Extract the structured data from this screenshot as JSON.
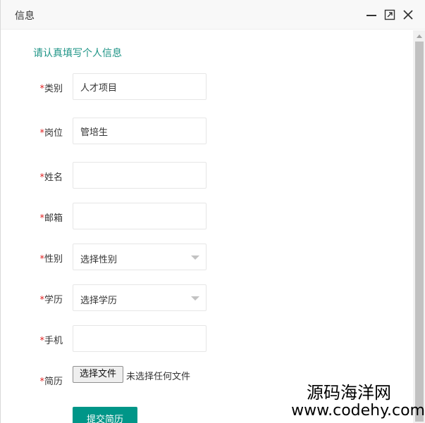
{
  "window": {
    "title": "信息",
    "minimize_icon": "minimize-icon",
    "maximize_icon": "maximize-icon",
    "close_icon": "close-icon"
  },
  "form": {
    "heading": "请认真填写个人信息",
    "required_mark": "*",
    "fields": [
      {
        "label": "类别",
        "type": "text",
        "value": "人才项目"
      },
      {
        "label": "岗位",
        "type": "text",
        "value": "管培生"
      },
      {
        "label": "姓名",
        "type": "text",
        "value": ""
      },
      {
        "label": "邮箱",
        "type": "text",
        "value": ""
      },
      {
        "label": "性别",
        "type": "select",
        "value": "选择性别"
      },
      {
        "label": "学历",
        "type": "select",
        "value": "选择学历"
      },
      {
        "label": "手机",
        "type": "text",
        "value": ""
      },
      {
        "label": "简历",
        "type": "file",
        "button_label": "选择文件",
        "status": "未选择任何文件"
      }
    ],
    "submit_label": "提交简历"
  },
  "watermark": {
    "line1": "源码海洋网",
    "line2": "www.codehy.com"
  },
  "colors": {
    "accent": "#009688",
    "heading": "#1e9486",
    "required": "#e02020"
  }
}
